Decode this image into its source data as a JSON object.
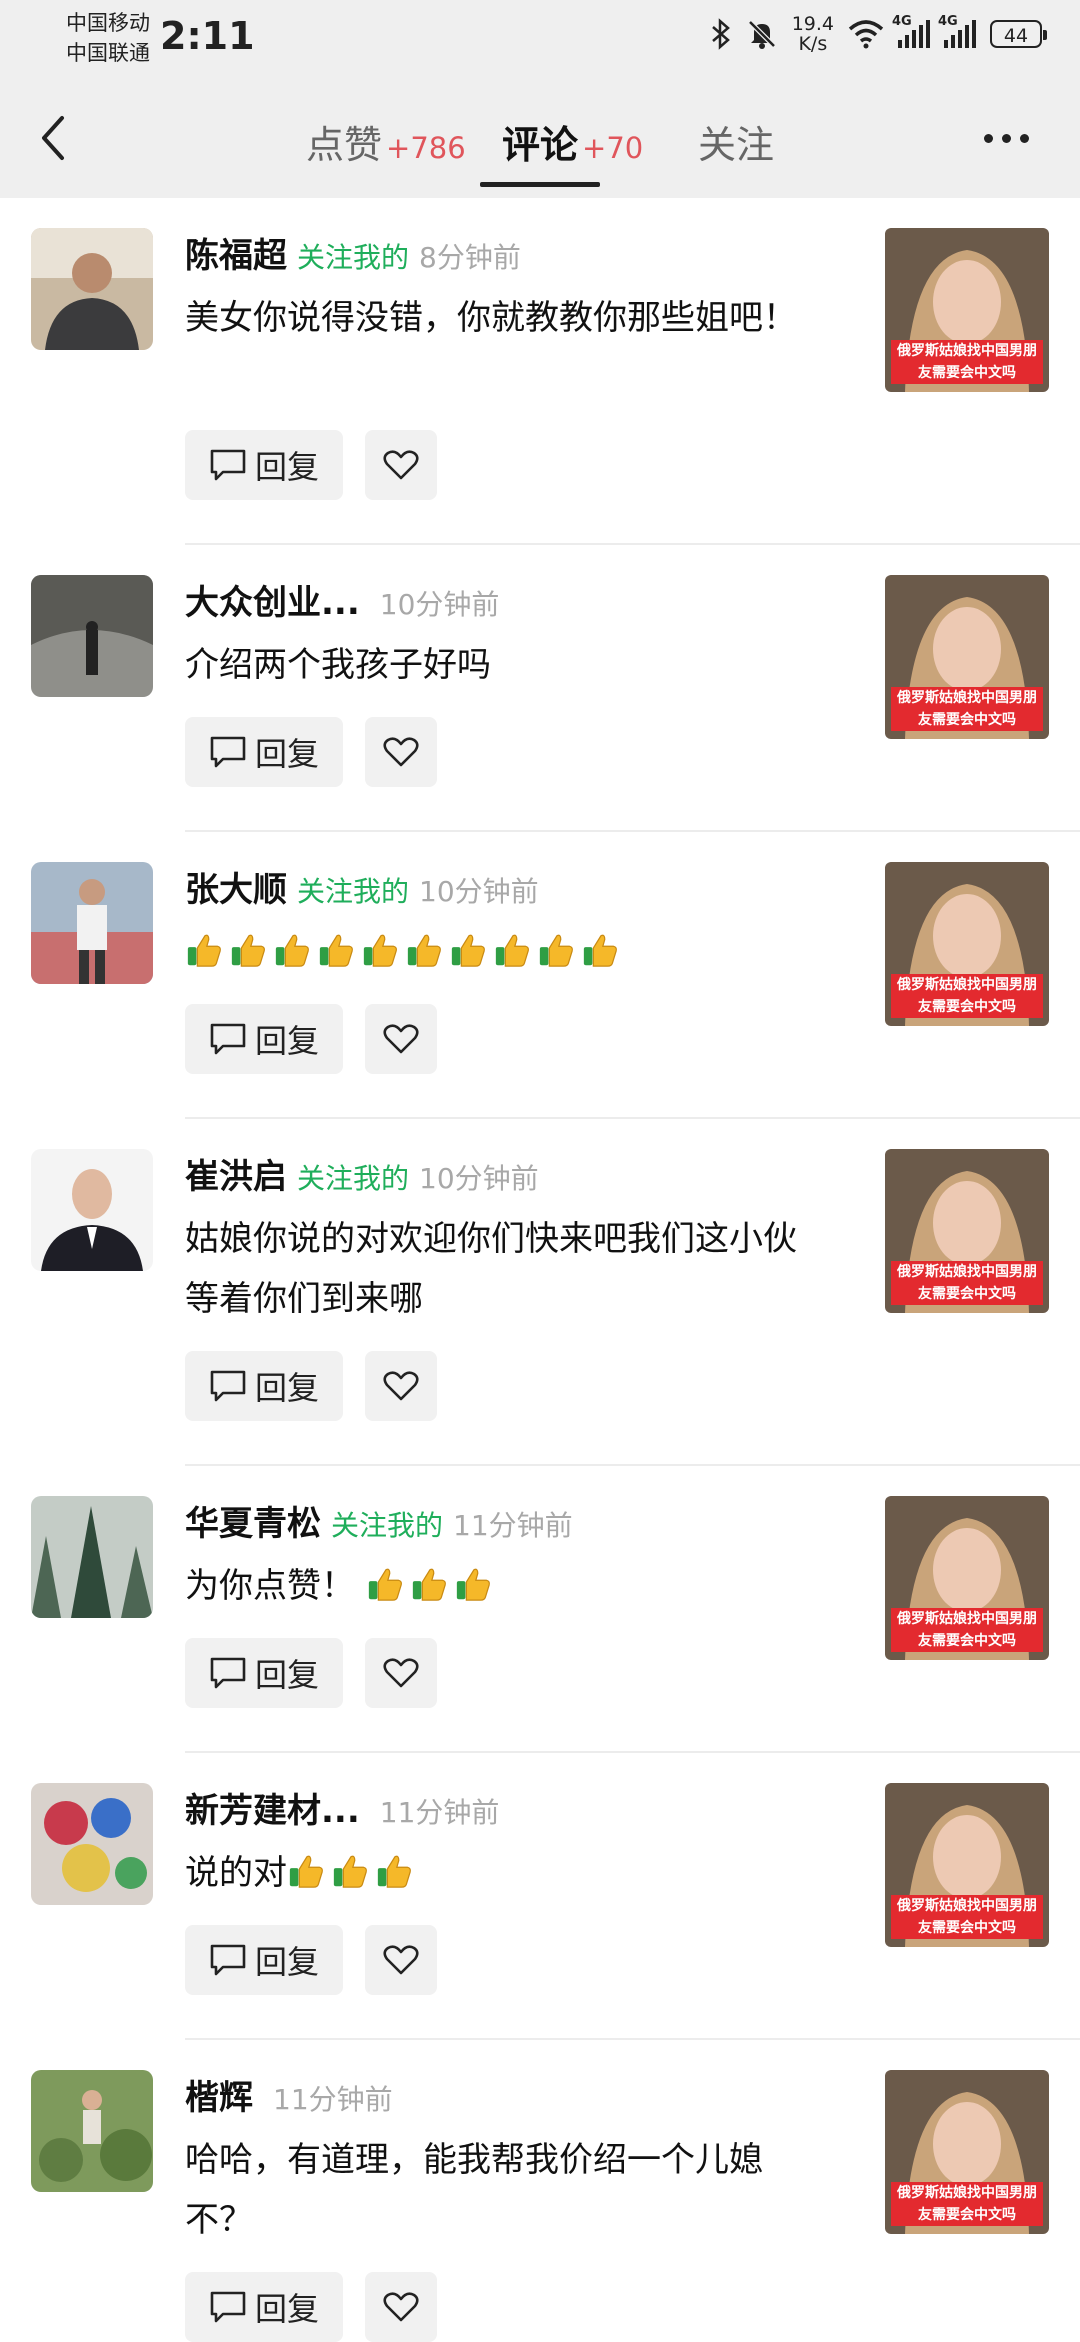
{
  "status_bar": {
    "carrier_1": "中国移动",
    "carrier_2": "中国联通",
    "time": "2:11",
    "net_speed_value": "19.4",
    "net_speed_unit": "K/s",
    "signal_label_1": "4G",
    "signal_label_2": "4G",
    "battery": "44",
    "icons": [
      "bluetooth-icon",
      "bell-off-icon",
      "wifi-icon",
      "signal-icon",
      "signal-icon",
      "battery-icon"
    ]
  },
  "header": {
    "tabs": [
      {
        "label": "点赞",
        "count": "+786"
      },
      {
        "label": "评论",
        "count": "+70"
      },
      {
        "label": "关注",
        "count": ""
      }
    ],
    "active_tab": 1,
    "icons": [
      "back-icon",
      "more-icon"
    ]
  },
  "actions": {
    "reply_label": "回复",
    "icons": [
      "comment-icon",
      "heart-icon"
    ]
  },
  "thumbnail_caption": "俄罗斯姑娘找中国男朋友需要会中文吗",
  "colors": {
    "follow_green": "#1fae5b",
    "count_red": "#e0555b",
    "time_gray": "#a8a8a8",
    "banner_red": "#e32a2f"
  },
  "comments": [
    {
      "name": "陈福超",
      "follow": "关注我的",
      "time": "8分钟前",
      "text": "美女你说得没错，你就教教你那些姐吧！",
      "emoji": 0
    },
    {
      "name": "大众创业...",
      "follow": "",
      "time": "10分钟前",
      "text": "介绍两个我孩子好吗",
      "emoji": 0
    },
    {
      "name": "张大顺",
      "follow": "关注我的",
      "time": "10分钟前",
      "text": "",
      "emoji": 10
    },
    {
      "name": "崔洪启",
      "follow": "关注我的",
      "time": "10分钟前",
      "text": "姑娘你说的对欢迎你们快来吧我们这小伙等着你们到来哪",
      "emoji": 0
    },
    {
      "name": "华夏青松",
      "follow": "关注我的",
      "time": "11分钟前",
      "text": "为你点赞！",
      "emoji": 3
    },
    {
      "name": "新芳建材...",
      "follow": "",
      "time": "11分钟前",
      "text": "说的对",
      "emoji": 3
    },
    {
      "name": "楷辉",
      "follow": "",
      "time": "11分钟前",
      "text": "哈哈，有道理，能我帮我价绍一个儿媳不？",
      "emoji": 0
    }
  ]
}
